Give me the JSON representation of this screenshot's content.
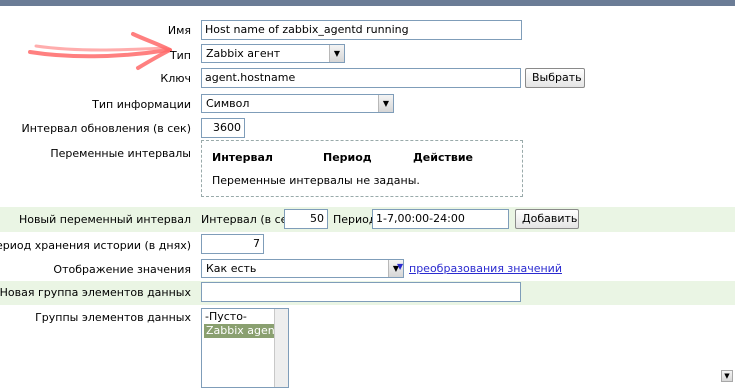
{
  "form": {
    "name": {
      "label": "Имя",
      "value": "Host name of zabbix_agentd running"
    },
    "type": {
      "label": "Тип",
      "value": "Zabbix агент"
    },
    "key": {
      "label": "Ключ",
      "value": "agent.hostname",
      "select_button": "Выбрать"
    },
    "info_type": {
      "label": "Тип информации",
      "value": "Символ"
    },
    "update_interval": {
      "label": "Интервал обновления (в сек)",
      "value": "3600"
    },
    "flex_intervals": {
      "label": "Переменные интервалы",
      "columns": [
        "Интервал",
        "Период",
        "Действие"
      ],
      "empty_text": "Переменные интервалы не заданы."
    },
    "new_flex": {
      "label": "Новый переменный интервал",
      "interval_label": "Интервал (в сек)",
      "interval_value": "50",
      "period_label": "Период",
      "period_value": "1-7,00:00-24:00",
      "add_button": "Добавить"
    },
    "history": {
      "label": "Период хранения истории (в днях)",
      "value": "7"
    },
    "show_value": {
      "label": "Отображение значения",
      "value": "Как есть",
      "link": "преобразования значений"
    },
    "new_app": {
      "label": "Новая группа элементов данных",
      "value": ""
    },
    "applications": {
      "label": "Группы элементов данных",
      "options": [
        "-Пусто-",
        "Zabbix agent"
      ],
      "selected_index": 1
    }
  },
  "colors": {
    "highlight_row": "#eaf5e4",
    "selected_option": "#8aa070",
    "link": "#2b2bd0",
    "annotation_arrow": "#ff6a6a"
  },
  "icons": {
    "dropdown": "chevron-down-icon",
    "annotation": "red-arrow-icon"
  }
}
